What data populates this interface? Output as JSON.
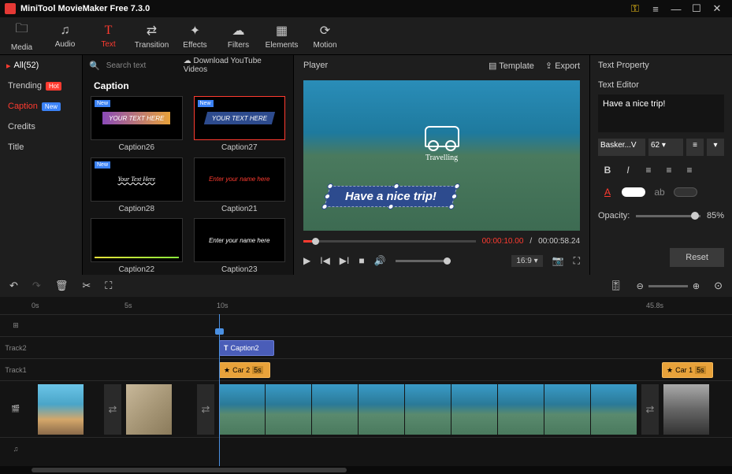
{
  "app": {
    "title": "MiniTool MovieMaker Free 7.3.0"
  },
  "toolbar": [
    {
      "label": "Media",
      "icon": "🗀"
    },
    {
      "label": "Audio",
      "icon": "♫"
    },
    {
      "label": "Text",
      "icon": "T",
      "active": true
    },
    {
      "label": "Transition",
      "icon": "⇄"
    },
    {
      "label": "Effects",
      "icon": "✦"
    },
    {
      "label": "Filters",
      "icon": "☁"
    },
    {
      "label": "Elements",
      "icon": "▦"
    },
    {
      "label": "Motion",
      "icon": "⟳"
    }
  ],
  "sidebar": {
    "header": "All(52)",
    "items": [
      {
        "label": "Trending",
        "badge": "Hot",
        "badgeClass": "hot"
      },
      {
        "label": "Caption",
        "badge": "New",
        "badgeClass": "new",
        "active": true
      },
      {
        "label": "Credits"
      },
      {
        "label": "Title"
      }
    ]
  },
  "library": {
    "search_placeholder": "Search text",
    "download": "Download YouTube Videos",
    "section": "Caption",
    "items": [
      {
        "name": "Caption26",
        "sample": "YOUR TEXT HERE",
        "new": true
      },
      {
        "name": "Caption27",
        "sample": "YOUR TEXT HERE",
        "new": true,
        "selected": true
      },
      {
        "name": "Caption28",
        "sample": "Your Text Here",
        "new": true
      },
      {
        "name": "Caption21",
        "sample": "Enter your name here"
      },
      {
        "name": "Caption22",
        "sample": ""
      },
      {
        "name": "Caption23",
        "sample": "Enter your name here"
      }
    ]
  },
  "player": {
    "title": "Player",
    "template": "Template",
    "export": "Export",
    "overlay_text": "Have a nice trip!",
    "illus_label": "Travelling",
    "current": "00:00:10.00",
    "total": "00:00:58.24",
    "aspect": "16:9"
  },
  "props": {
    "title": "Text Property",
    "editor_label": "Text Editor",
    "text": "Have a nice trip!",
    "font": "Basker...V",
    "size": "62",
    "opacity_label": "Opacity:",
    "opacity": "85%",
    "reset": "Reset"
  },
  "timeline": {
    "marks": [
      "0s",
      "5s",
      "10s",
      "45.8s"
    ],
    "tracks": {
      "t2": "Track2",
      "t1": "Track1"
    },
    "clips": {
      "caption": "Caption2",
      "car2": "Car 2",
      "car2_dur": "5s",
      "car1": "Car 1",
      "car1_dur": "5s"
    }
  }
}
